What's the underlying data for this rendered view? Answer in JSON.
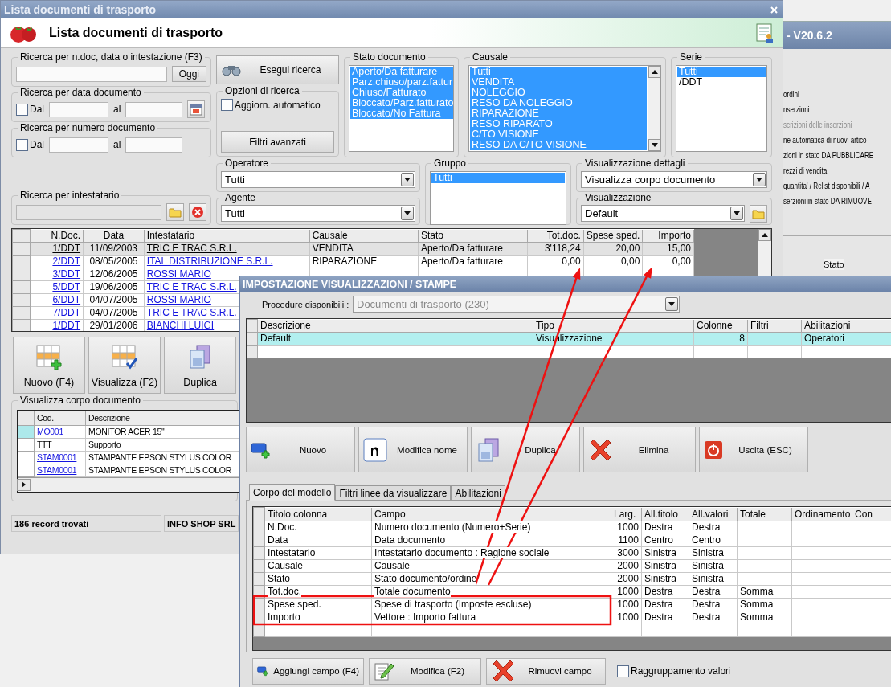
{
  "background_window": {
    "title": "- V20.6.2",
    "items": [
      {
        "label": "ordini",
        "disabled": false
      },
      {
        "label": "nserzioni",
        "disabled": false
      },
      {
        "label": "scrizioni delle inserzioni",
        "disabled": true
      },
      {
        "label": "ne automatica di nuovi artico",
        "disabled": false
      },
      {
        "label": "zioni in stato DA PUBBLICARE",
        "disabled": false
      },
      {
        "label": "rezzi di vendita",
        "disabled": false
      },
      {
        "label": "quantita' / Relist disponibili / A",
        "disabled": false
      },
      {
        "label": "serzioni in stato DA RIMUOVE",
        "disabled": false
      }
    ],
    "column_header": "Stato"
  },
  "main_window": {
    "title": "Lista documenti di trasporto",
    "heading": "Lista documenti di trasporto",
    "text_search": {
      "legend": "Ricerca per n.doc, data o intestazione (F3)",
      "button": "Oggi"
    },
    "date_search": {
      "legend": "Ricerca per data documento",
      "from_label": "Dal",
      "from_checked": false,
      "to_label": "al"
    },
    "number_search": {
      "legend": "Ricerca per numero documento",
      "from_label": "Dal",
      "from_checked": false,
      "to_label": "al"
    },
    "search_button": "Esegui ricerca",
    "options": {
      "legend": "Opzioni di ricerca",
      "auto_update": {
        "label": "Aggiorn. automatico",
        "checked": false
      },
      "advanced_button": "Filtri avanzati"
    },
    "stato_documento": {
      "legend": "Stato documento",
      "items": [
        {
          "label": "Aperto/Da fatturare",
          "selected": true
        },
        {
          "label": "Parz.chiuso/parz.fattur",
          "selected": true
        },
        {
          "label": "Chiuso/Fatturato",
          "selected": true
        },
        {
          "label": "Bloccato/Parz.fatturato",
          "selected": true
        },
        {
          "label": "Bloccato/No Fattura",
          "selected": true
        }
      ]
    },
    "causale": {
      "legend": "Causale",
      "items": [
        {
          "label": "Tutti",
          "selected": true
        },
        {
          "label": "VENDITA",
          "selected": true
        },
        {
          "label": "NOLEGGIO",
          "selected": true
        },
        {
          "label": "RESO DA NOLEGGIO",
          "selected": true
        },
        {
          "label": "RIPARAZIONE",
          "selected": true
        },
        {
          "label": "RESO RIPARATO",
          "selected": true
        },
        {
          "label": "C/TO VISIONE",
          "selected": true
        },
        {
          "label": "RESO DA C/TO VISIONE",
          "selected": true
        }
      ]
    },
    "serie": {
      "legend": "Serie",
      "items": [
        {
          "label": "Tutti",
          "selected": true
        },
        {
          "label": "/DDT",
          "selected": false
        }
      ]
    },
    "intestatario": {
      "legend": "Ricerca per intestatario"
    },
    "operatore": {
      "legend": "Operatore",
      "value": "Tutti"
    },
    "agente": {
      "legend": "Agente",
      "value": "Tutti"
    },
    "gruppo": {
      "legend": "Gruppo",
      "items": [
        {
          "label": "Tutti",
          "selected": true
        }
      ]
    },
    "visualizzazione_dettagli": {
      "legend": "Visualizzazione dettagli",
      "value": "Visualizza corpo documento"
    },
    "visualizzazione": {
      "legend": "Visualizzazione",
      "value": "Default"
    },
    "table": {
      "columns": [
        "N.Doc.",
        "Data",
        "Intestatario",
        "Causale",
        "Stato",
        "Tot.doc.",
        "Spese sped.",
        "Importo"
      ],
      "rows": [
        {
          "selected": true,
          "n_doc": "1/DDT",
          "data": "11/09/2003",
          "intestatario": "TRIC E TRAC S.R.L.",
          "causale": "VENDITA",
          "stato": "Aperto/Da fatturare",
          "tot_doc": "3'118,24",
          "spese_sped": "20,00",
          "importo": "15,00"
        },
        {
          "selected": false,
          "n_doc": "2/DDT",
          "data": "08/05/2005",
          "intestatario": "ITAL DISTRIBUZIONE S.R.L.",
          "causale": "RIPARAZIONE",
          "stato": "Aperto/Da fatturare",
          "tot_doc": "0,00",
          "spese_sped": "0,00",
          "importo": "0,00"
        },
        {
          "selected": false,
          "n_doc": "3/DDT",
          "data": "12/06/2005",
          "intestatario": "ROSSI MARIO"
        },
        {
          "selected": false,
          "n_doc": "5/DDT",
          "data": "19/06/2005",
          "intestatario": "TRIC E TRAC S.R.L."
        },
        {
          "selected": false,
          "n_doc": "6/DDT",
          "data": "04/07/2005",
          "intestatario": "ROSSI MARIO"
        },
        {
          "selected": false,
          "n_doc": "7/DDT",
          "data": "04/07/2005",
          "intestatario": "TRIC E TRAC S.R.L."
        },
        {
          "selected": false,
          "n_doc": "1/DDT",
          "data": "29/01/2006",
          "intestatario": "BIANCHI LUIGI"
        }
      ]
    },
    "action_buttons": [
      {
        "label": "Nuovo (F4)",
        "kind": "new_row"
      },
      {
        "label": "Visualizza (F2)",
        "kind": "view_row"
      },
      {
        "label": "Duplica",
        "kind": "duplicate"
      }
    ],
    "detail_panel": {
      "legend": "Visualizza corpo documento",
      "columns": [
        "Cod.",
        "Descrizione"
      ],
      "rows": [
        {
          "code": "MO001",
          "description": "MONITOR ACER 15\"",
          "link": true,
          "selected": true
        },
        {
          "code": "TTT",
          "description": "Supporto",
          "link": false,
          "selected": false
        },
        {
          "code": "STAM0001",
          "description": "STAMPANTE EPSON STYLUS COLOR",
          "link": true,
          "selected": false
        },
        {
          "code": "STAM0001",
          "description": "STAMPANTE EPSON STYLUS COLOR",
          "link": true,
          "selected": false
        }
      ]
    },
    "status_bar": [
      "186 record trovati",
      "INFO SHOP SRL"
    ]
  },
  "dialog": {
    "title": "IMPOSTAZIONE VISUALIZZAZIONI / STAMPE",
    "procedure": {
      "label": "Procedure disponibili :",
      "value": "Documenti di trasporto (230)",
      "disabled": true
    },
    "views": {
      "columns": [
        "Descrizione",
        "Tipo",
        "Colonne",
        "Filtri",
        "Abilitazioni"
      ],
      "rows": [
        {
          "descrizione": "Default",
          "tipo": "Visualizzazione",
          "colonne": "8",
          "abilitazioni": "Operatori",
          "selected": true
        }
      ]
    },
    "buttons": [
      {
        "label": "Nuovo",
        "kind": "new"
      },
      {
        "label": "Modifica nome",
        "kind": "rename"
      },
      {
        "label": "Duplica",
        "kind": "duplicate"
      },
      {
        "label": "Elimina",
        "kind": "delete"
      },
      {
        "label": "Uscita (ESC)",
        "kind": "exit"
      }
    ],
    "tabs": [
      {
        "label": "Corpo del modello",
        "selected": true
      },
      {
        "label": "Filtri linee da visualizzare",
        "selected": false
      },
      {
        "label": "Abilitazioni",
        "selected": false
      }
    ],
    "fields": {
      "columns": [
        "Titolo colonna",
        "Campo",
        "Larg.",
        "All.titolo",
        "All.valori",
        "Totale",
        "Ordinamento",
        "Con"
      ],
      "rows": [
        [
          "N.Doc.",
          "Numero documento (Numero+Serie)",
          "1000",
          "Destra",
          "Destra"
        ],
        [
          "Data",
          "Data documento",
          "1100",
          "Centro",
          "Centro"
        ],
        [
          "Intestatario",
          "Intestatario documento : Ragione sociale",
          "3000",
          "Sinistra",
          "Sinistra"
        ],
        [
          "Causale",
          "Causale",
          "2000",
          "Sinistra",
          "Sinistra"
        ],
        [
          "Stato",
          "Stato documento/ordine",
          "2000",
          "Sinistra",
          "Sinistra"
        ],
        [
          "Tot.doc.",
          "Totale documento",
          "1000",
          "Destra",
          "Destra",
          "Somma"
        ],
        [
          "Spese sped.",
          "Spese di trasporto (Imposte escluse)",
          "1000",
          "Destra",
          "Destra",
          "Somma"
        ],
        [
          "Importo",
          "Vettore : Importo fattura",
          "1000",
          "Destra",
          "Destra",
          "Somma"
        ]
      ]
    },
    "bottom_buttons": [
      {
        "label": "Aggiungi campo (F4)",
        "kind": "add_field"
      },
      {
        "label": "Modifica (F2)",
        "kind": "edit"
      },
      {
        "label": "Rimuovi campo",
        "kind": "remove"
      }
    ],
    "grouping": {
      "label": "Raggruppamento valori",
      "checked": false
    }
  }
}
